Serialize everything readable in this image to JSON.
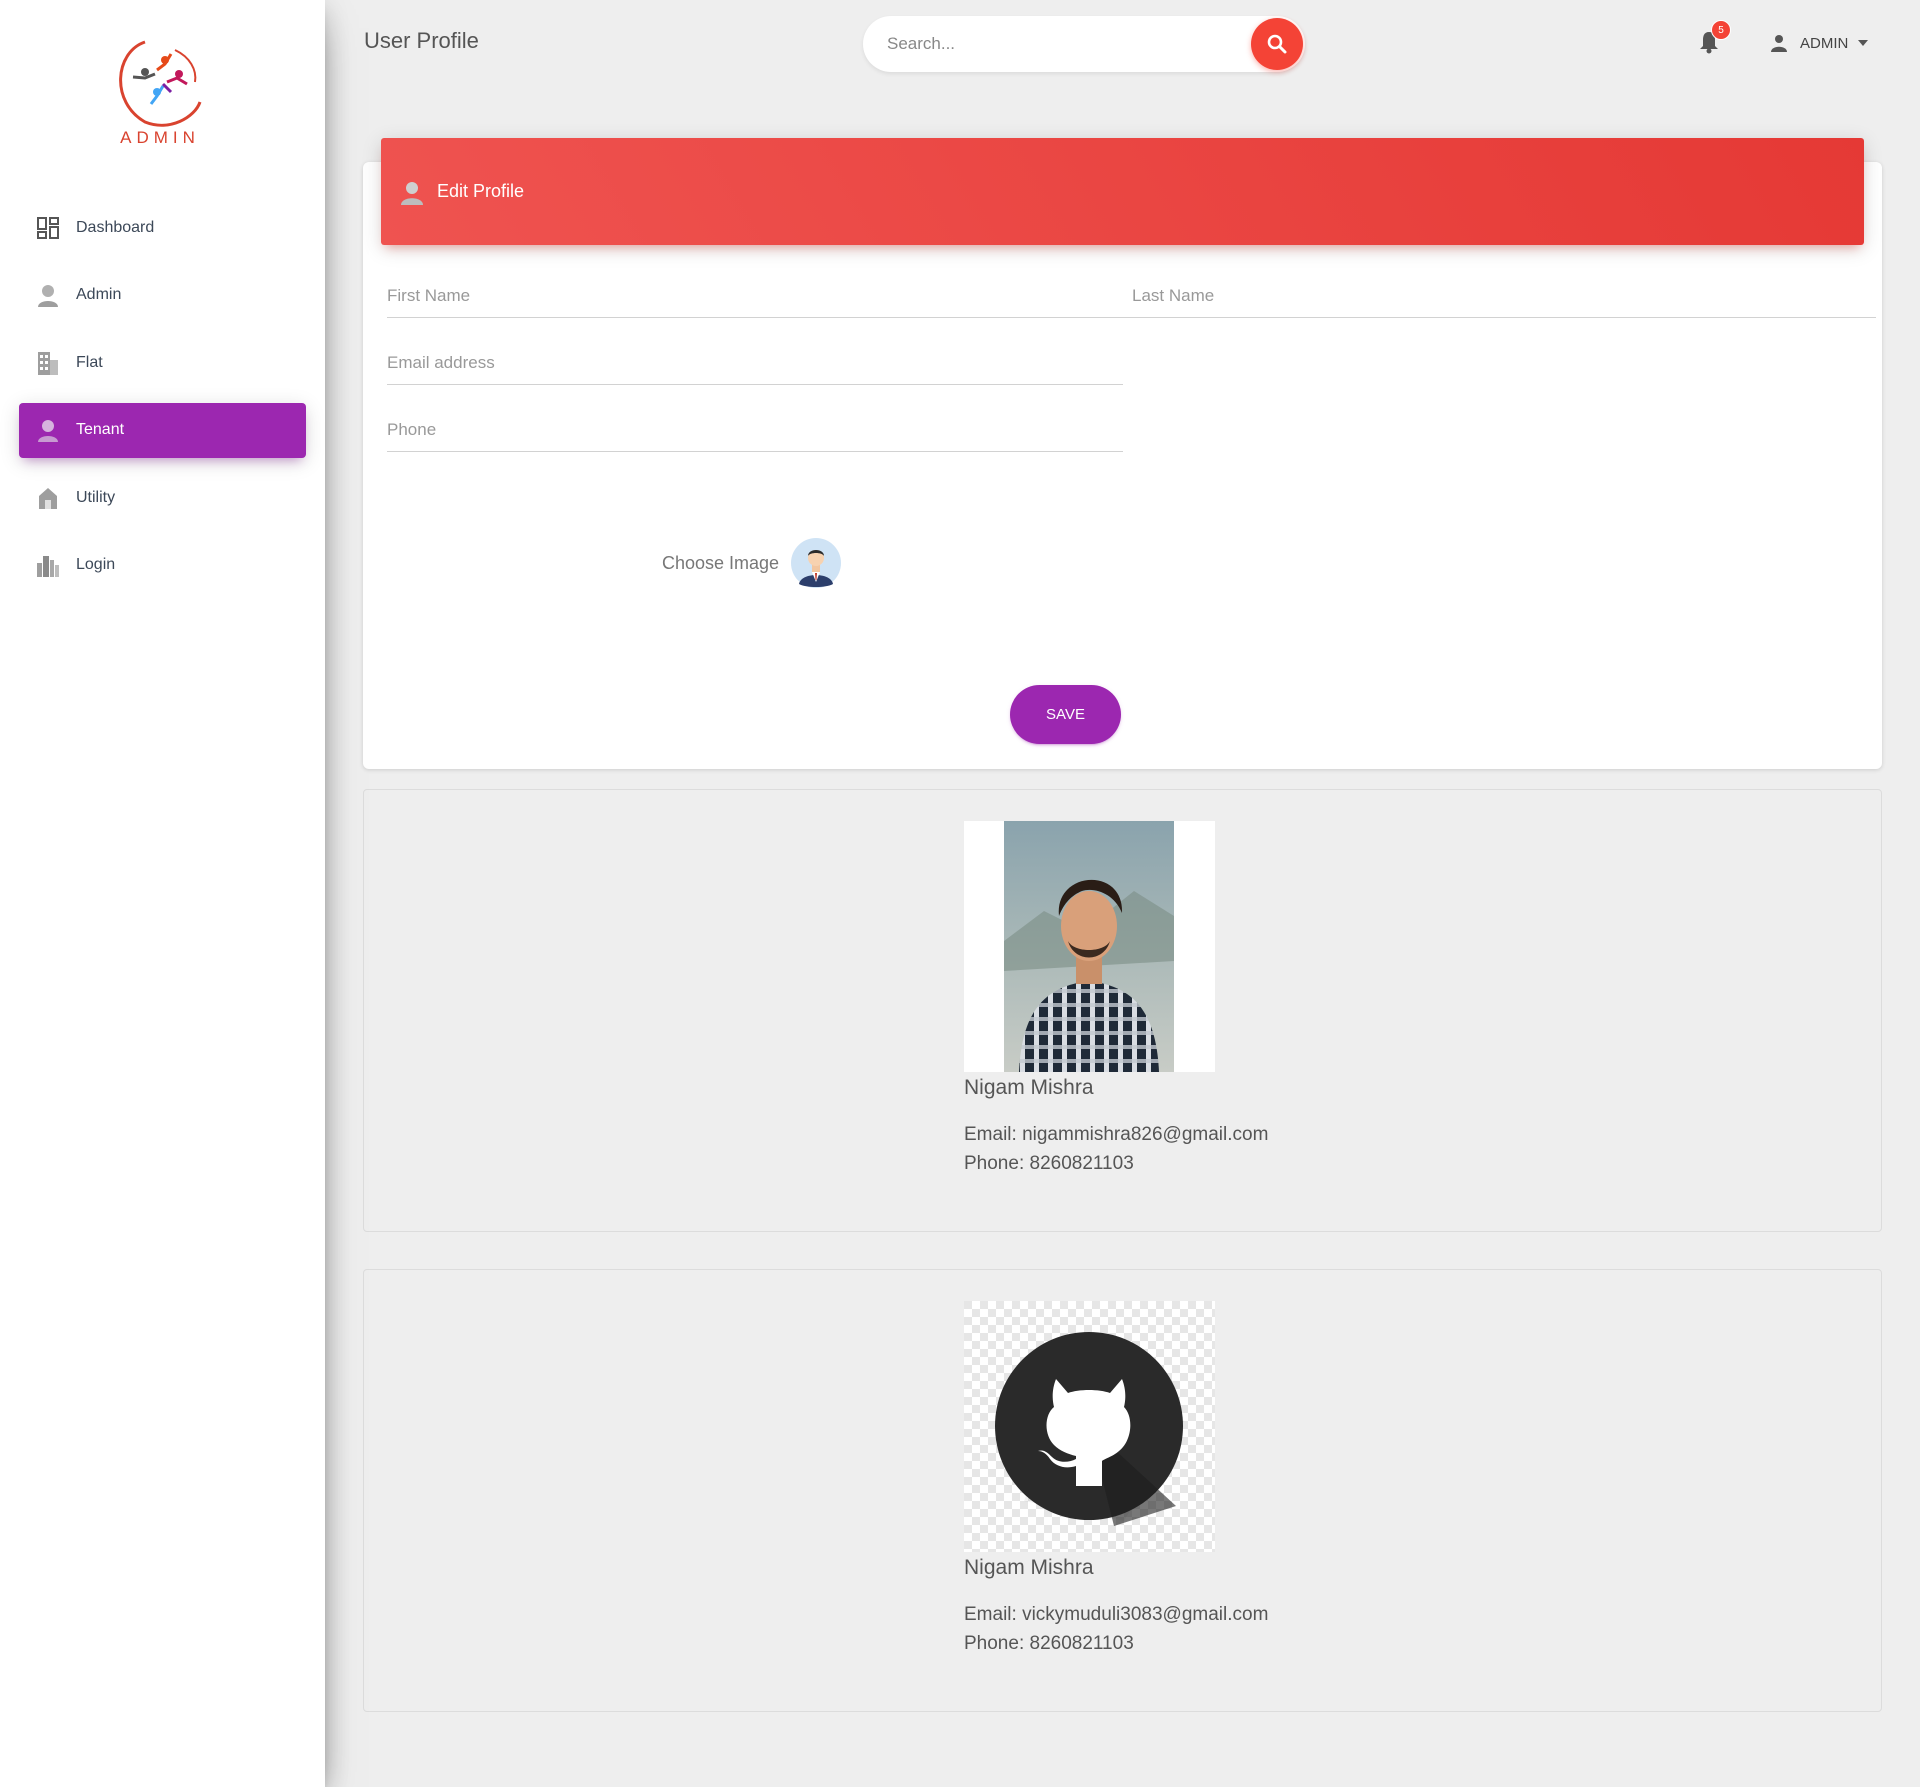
{
  "logo": {
    "text": "ADMIN"
  },
  "sidebar": {
    "items": [
      {
        "label": "Dashboard",
        "icon": "dashboard-icon"
      },
      {
        "label": "Admin",
        "icon": "person-icon"
      },
      {
        "label": "Flat",
        "icon": "building-icon"
      },
      {
        "label": "Tenant",
        "icon": "person-icon",
        "active": true
      },
      {
        "label": "Utility",
        "icon": "home-icon"
      },
      {
        "label": "Login",
        "icon": "city-icon"
      }
    ]
  },
  "header": {
    "title": "User Profile",
    "search_placeholder": "Search...",
    "notification_count": "5",
    "user_name": "ADMIN"
  },
  "edit_profile": {
    "title": "Edit Profile",
    "first_name_placeholder": "First Name",
    "last_name_placeholder": "Last Name",
    "email_placeholder": "Email address",
    "phone_placeholder": "Phone",
    "choose_image_label": "Choose Image",
    "save_label": "SAVE"
  },
  "profiles": [
    {
      "name": "Nigam Mishra",
      "email": "Email: nigammishra826@gmail.com",
      "phone": "Phone: 8260821103",
      "image": "person-photo"
    },
    {
      "name": "Nigam Mishra",
      "email": "Email: vickymuduli3083@gmail.com",
      "phone": "Phone: 8260821103",
      "image": "github-logo"
    }
  ],
  "colors": {
    "accent_purple": "#9c27b0",
    "header_red": "#e53935",
    "search_red": "#f44336",
    "background": "#eeeeee"
  }
}
